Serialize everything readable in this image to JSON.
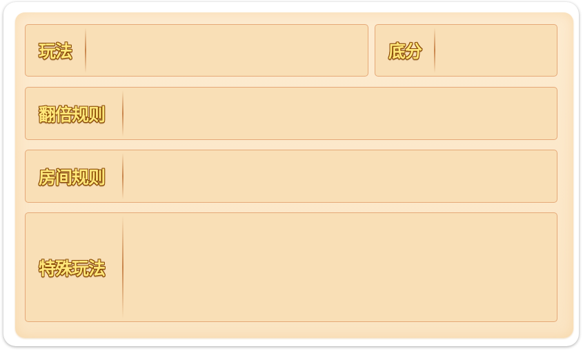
{
  "rules": {
    "mode_label": "玩法",
    "mode_value": "",
    "base_score_label": "底分",
    "base_score_value": "",
    "multiplier_label": "翻倍规则",
    "multiplier_value": "",
    "room_rule_label": "房间规则",
    "room_rule_value": "",
    "special_label": "特殊玩法",
    "special_value": ""
  }
}
